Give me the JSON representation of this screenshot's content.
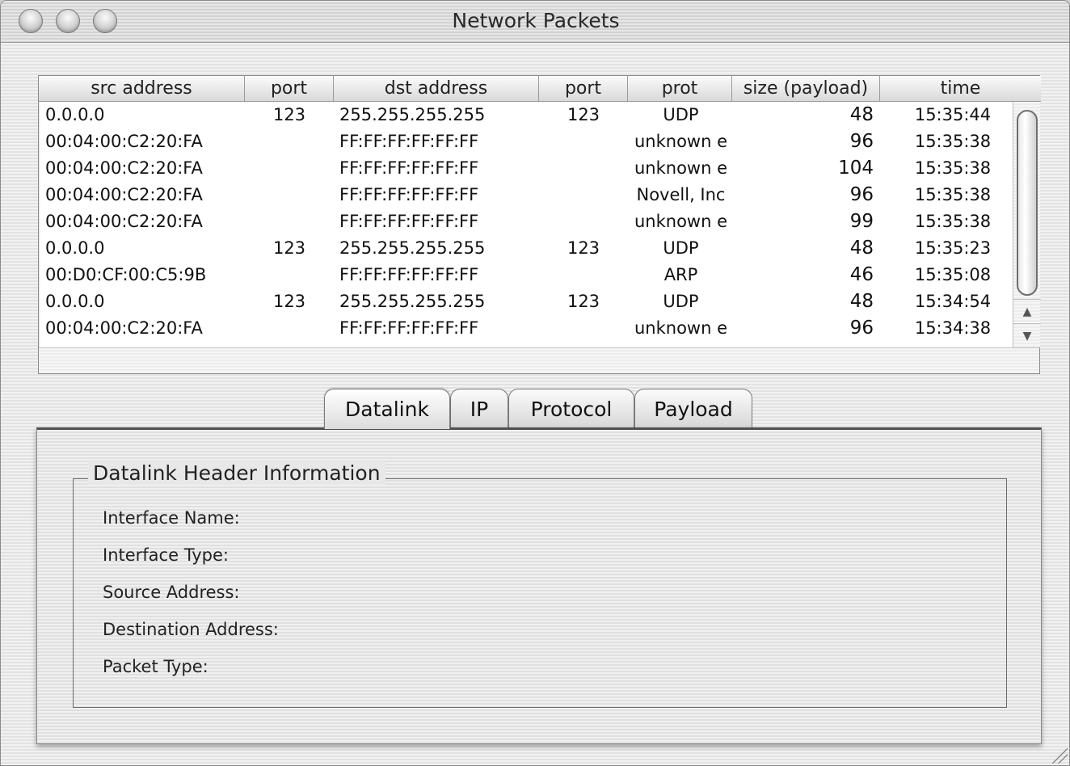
{
  "window": {
    "title": "Network Packets"
  },
  "table": {
    "columns": [
      "src address",
      "port",
      "dst address",
      "port",
      "prot",
      "size (payload)",
      "time"
    ],
    "rows": [
      [
        "0.0.0.0",
        "123",
        "255.255.255.255",
        "123",
        "UDP",
        "48",
        "15:35:44"
      ],
      [
        "00:04:00:C2:20:FA",
        "",
        "FF:FF:FF:FF:FF:FF",
        "",
        "unknown e",
        "96",
        "15:35:38"
      ],
      [
        "00:04:00:C2:20:FA",
        "",
        "FF:FF:FF:FF:FF:FF",
        "",
        "unknown e",
        "104",
        "15:35:38"
      ],
      [
        "00:04:00:C2:20:FA",
        "",
        "FF:FF:FF:FF:FF:FF",
        "",
        "Novell, Inc",
        "96",
        "15:35:38"
      ],
      [
        "00:04:00:C2:20:FA",
        "",
        "FF:FF:FF:FF:FF:FF",
        "",
        "unknown e",
        "99",
        "15:35:38"
      ],
      [
        "0.0.0.0",
        "123",
        "255.255.255.255",
        "123",
        "UDP",
        "48",
        "15:35:23"
      ],
      [
        "00:D0:CF:00:C5:9B",
        "",
        "FF:FF:FF:FF:FF:FF",
        "",
        "ARP",
        "46",
        "15:35:08"
      ],
      [
        "0.0.0.0",
        "123",
        "255.255.255.255",
        "123",
        "UDP",
        "48",
        "15:34:54"
      ],
      [
        "00:04:00:C2:20:FA",
        "",
        "FF:FF:FF:FF:FF:FF",
        "",
        "unknown e",
        "96",
        "15:34:38"
      ]
    ]
  },
  "tabs": [
    "Datalink",
    "IP",
    "Protocol",
    "Payload"
  ],
  "active_tab": "Datalink",
  "details": {
    "group_title": "Datalink Header Information",
    "fields": [
      "Interface Name:",
      "Interface Type:",
      "Source Address:",
      "Destination Address:",
      "Packet Type:"
    ]
  },
  "icons": {
    "close": "traffic-light-close-icon",
    "minimize": "traffic-light-minimize-icon",
    "zoom": "traffic-light-zoom-icon",
    "scroll_up": "arrow-up-icon",
    "scroll_down": "arrow-down-icon",
    "resize": "resize-grip-icon"
  }
}
